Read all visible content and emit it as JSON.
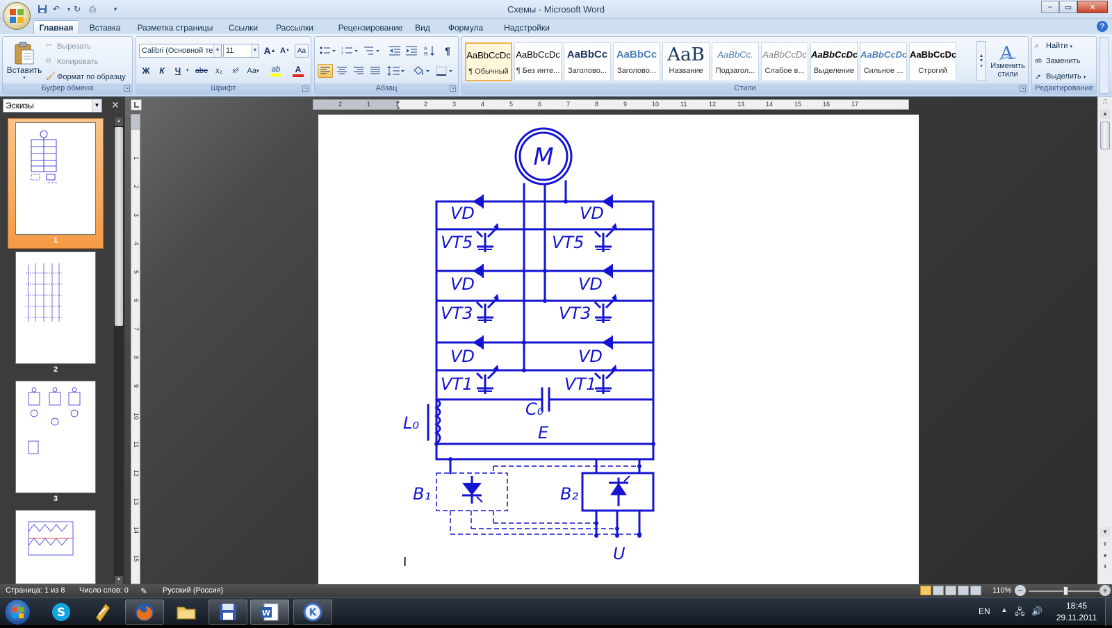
{
  "window": {
    "title": "Схемы - Microsoft Word",
    "controls": {
      "minimize": "–",
      "maximize": "▭",
      "close": "✕"
    },
    "help": "?"
  },
  "quick_access": {
    "save": "💾",
    "undo": "↶",
    "redo": "↻",
    "print": "⎙",
    "customize": "▾"
  },
  "tabs": [
    "Главная",
    "Вставка",
    "Разметка страницы",
    "Ссылки",
    "Рассылки",
    "Рецензирование",
    "Вид",
    "Формула",
    "Надстройки"
  ],
  "active_tab": "Главная",
  "ribbon": {
    "clipboard": {
      "label": "Буфер обмена",
      "paste": "Вставить",
      "cut": "Вырезать",
      "copy": "Копировать",
      "format_painter": "Формат по образцу"
    },
    "font": {
      "label": "Шрифт",
      "font_name": "Calibri (Основной те",
      "font_size": "11",
      "grow": "A",
      "shrink": "A",
      "clear": "Aa",
      "bold": "Ж",
      "italic": "К",
      "underline": "Ч",
      "strike": "abe",
      "subscript": "x₂",
      "superscript": "x²",
      "case": "Aa",
      "highlight": "ab",
      "color": "A",
      "highlight_color": "#ffff00",
      "font_color": "#e0201b"
    },
    "paragraph": {
      "label": "Абзац",
      "pilcrow": "¶"
    },
    "styles": {
      "label": "Стили",
      "items": [
        {
          "sample": "AaBbCcDc",
          "name": "¶ Обычный",
          "color": "#000000"
        },
        {
          "sample": "AaBbCcDc",
          "name": "¶ Без инте...",
          "color": "#000000"
        },
        {
          "sample": "AaBbCc",
          "name": "Заголово...",
          "color": "#17365d"
        },
        {
          "sample": "AaBbCc",
          "name": "Заголово...",
          "color": "#4f81bd"
        },
        {
          "sample": "AaB",
          "name": "Название",
          "color": "#17365d"
        },
        {
          "sample": "AaBbCc.",
          "name": "Подзагол...",
          "color": "#4f81bd"
        },
        {
          "sample": "AaBbCcDc",
          "name": "Слабое в...",
          "color": "#808080"
        },
        {
          "sample": "AaBbCcDc",
          "name": "Выделение",
          "color": "#000000"
        },
        {
          "sample": "AaBbCcDc",
          "name": "Сильное ...",
          "color": "#4f81bd"
        },
        {
          "sample": "AaBbCcDc",
          "name": "Строгий",
          "color": "#000000"
        }
      ],
      "change_styles_1": "Изменить",
      "change_styles_2": "стили"
    },
    "editing": {
      "label": "Редактирование",
      "find": "Найти",
      "replace": "Заменить",
      "select": "Выделить"
    }
  },
  "navigation_pane": {
    "view": "Эскизы",
    "close": "✕",
    "pages": [
      "1",
      "2",
      "3"
    ]
  },
  "ruler": {
    "h_numbers": [
      "2",
      "1",
      "1",
      "2",
      "3",
      "4",
      "5",
      "6",
      "7",
      "8",
      "9",
      "10",
      "11",
      "12",
      "13",
      "14",
      "15",
      "16",
      "17"
    ],
    "v_numbers": [
      "1",
      "2",
      "3",
      "4",
      "5",
      "6",
      "7",
      "8",
      "9",
      "10",
      "11",
      "12",
      "13",
      "14",
      "15"
    ]
  },
  "schematic": {
    "motor": "M",
    "diode_label": "VD",
    "transistor_rows": [
      "VT5",
      "VT3",
      "VT1"
    ],
    "capacitor": "C₀",
    "inductor": "L₀",
    "source": "E",
    "block_1": "B₁",
    "block_2": "B₂",
    "voltage": "U",
    "cursor": "I",
    "line_color": "#1414d2"
  },
  "status": {
    "page": "Страница: 1 из 8",
    "words": "Число слов: 0",
    "language": "Русский (Россия)",
    "zoom": "110%"
  },
  "taskbar": {
    "language": "EN",
    "time": "18:45",
    "date": "29.11.2011"
  }
}
